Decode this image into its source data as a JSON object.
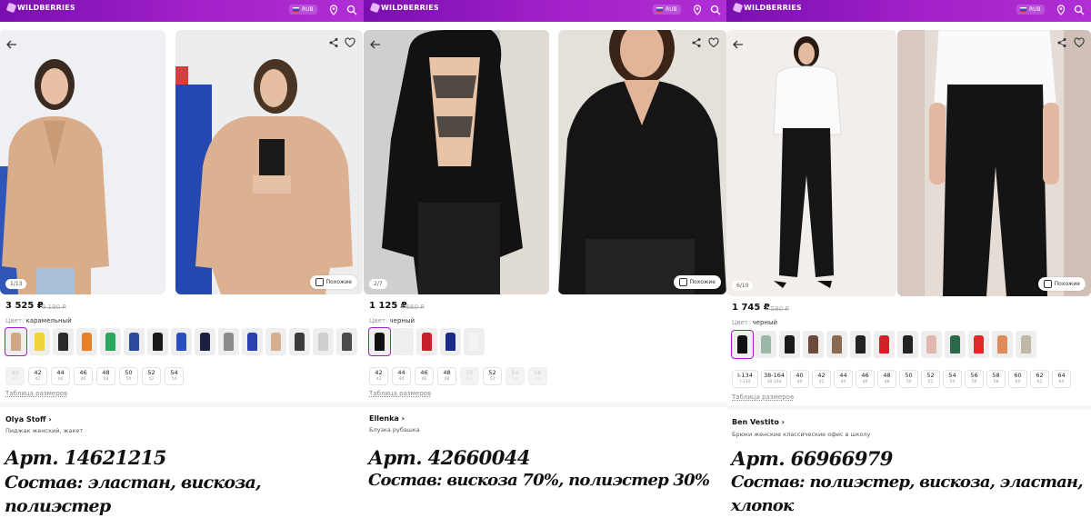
{
  "header": {
    "logo": "WILDBERRIES",
    "currency": "RUB"
  },
  "similar_label": "Похожие",
  "color_prefix": "Цвет:",
  "size_table_label": "Таблица размеров",
  "products": [
    {
      "counter": "1/13",
      "price": "3 525 ₽",
      "old_price": "9 190 ₽",
      "color": "карамельный",
      "sizes": [
        [
          "40",
          "40",
          false
        ],
        [
          "42",
          "42",
          true
        ],
        [
          "44",
          "44",
          true
        ],
        [
          "46",
          "46",
          true
        ],
        [
          "48",
          "48",
          true
        ],
        [
          "50",
          "50",
          true
        ],
        [
          "52",
          "52",
          true
        ],
        [
          "54",
          "54",
          true
        ]
      ],
      "brand": "Olya Stoff",
      "product_name": "Пиджак женский, жакет",
      "article": "Арт. 14621215",
      "composition": "Состав: эластан, вискоза, полиэстер"
    },
    {
      "counter": "2/7",
      "price": "1 125 ₽",
      "old_price": "4 660 ₽",
      "color": "черный",
      "sizes": [
        [
          "42",
          "42",
          true
        ],
        [
          "44",
          "44",
          true
        ],
        [
          "46",
          "46",
          true
        ],
        [
          "48",
          "48",
          true
        ],
        [
          "50",
          "50",
          false
        ],
        [
          "52",
          "52",
          true
        ],
        [
          "54",
          "54",
          false
        ],
        [
          "56",
          "56",
          false
        ]
      ],
      "brand": "Ellenka",
      "product_name": "Блузка рубашка",
      "article": "Арт. 42660044",
      "composition": "Состав: вискоза 70%, полиэстер 30%"
    },
    {
      "counter": "6/10",
      "price": "1 745 ₽",
      "old_price": "7 590 ₽",
      "color": "черный",
      "sizes": [
        [
          "I-134",
          "I-134",
          true
        ],
        [
          "38-164",
          "38-164",
          true
        ],
        [
          "40",
          "40",
          true
        ],
        [
          "42",
          "42",
          true
        ],
        [
          "44",
          "44",
          true
        ],
        [
          "46",
          "46",
          true
        ],
        [
          "48",
          "48",
          true
        ],
        [
          "50",
          "50",
          true
        ],
        [
          "52",
          "52",
          true
        ],
        [
          "54",
          "54",
          true
        ],
        [
          "56",
          "56",
          true
        ],
        [
          "58",
          "58",
          true
        ],
        [
          "60",
          "60",
          true
        ],
        [
          "62",
          "62",
          true
        ],
        [
          "64",
          "64",
          true
        ]
      ],
      "brand": "Ben Vestito",
      "product_name": "Брюки женские классические офис в школу",
      "article": "Арт. 66966979",
      "composition": "Состав: полиэстер, вискоза, эластан, хлопок"
    }
  ],
  "colors": {
    "brand_purple": "#a020c8",
    "swatch_sets": [
      [
        "#cfa88a",
        "#f0d23a",
        "#2a2a2a",
        "#e8802a",
        "#2aa85a",
        "#2a4aa0",
        "#1a1a1a",
        "#2a50c0",
        "#1a2040",
        "#8a8a8a",
        "#2a40b0",
        "#d4b090",
        "#3a3a3a",
        "#cfcfcf",
        "#4a4a4a"
      ],
      [
        "#111111",
        "#eeeeee",
        "#c8202a",
        "#1a2a8a",
        "#f4f4f4"
      ],
      [
        "#111111",
        "#9ab8a8",
        "#1a1a1a",
        "#6a4a3a",
        "#8a6a50",
        "#222222",
        "#d02028",
        "#222222",
        "#e0b8b0",
        "#2a6a4a",
        "#e02a2a",
        "#e08a5a",
        "#c0b8a8"
      ]
    ]
  }
}
